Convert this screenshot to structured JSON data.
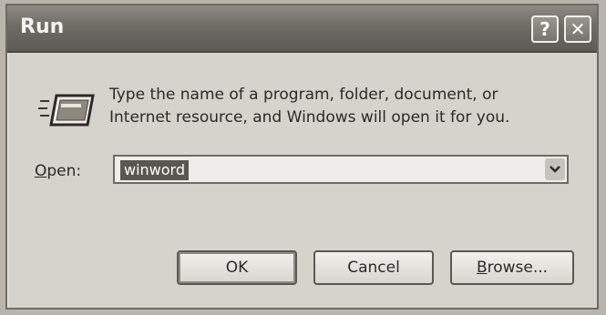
{
  "window": {
    "title": "Run",
    "help_glyph": "?",
    "close_glyph": "✕",
    "icon": "run-icon"
  },
  "content": {
    "description_line1": "Type the name of a program, folder, document, or",
    "description_line2": "Internet resource, and Windows will open it for you."
  },
  "open": {
    "label_mnemonic": "O",
    "label_rest": "pen:",
    "value": "winword"
  },
  "buttons": {
    "ok": "OK",
    "cancel": "Cancel",
    "browse_mnemonic": "B",
    "browse_rest": "rowse..."
  }
}
